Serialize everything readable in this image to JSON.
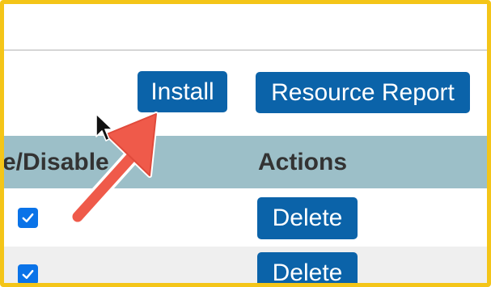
{
  "toolbar": {
    "install_label": "Install",
    "resource_report_label": "Resource Report"
  },
  "table": {
    "columns": [
      "e/Disable",
      "Actions"
    ],
    "rows": [
      {
        "enabled": true,
        "action_label": "Delete"
      },
      {
        "enabled": true,
        "action_label": "Delete"
      }
    ]
  },
  "colors": {
    "button": "#0b63a9",
    "header_bg": "#9cbfc8",
    "checkbox": "#0a73e8",
    "frame": "#f4c518",
    "annotation_arrow": "#ef5a4a"
  },
  "icons": {
    "cursor": "mouse-pointer-icon",
    "annotation": "red-arrow-annotation-icon",
    "checkbox": "checkmark-icon"
  }
}
